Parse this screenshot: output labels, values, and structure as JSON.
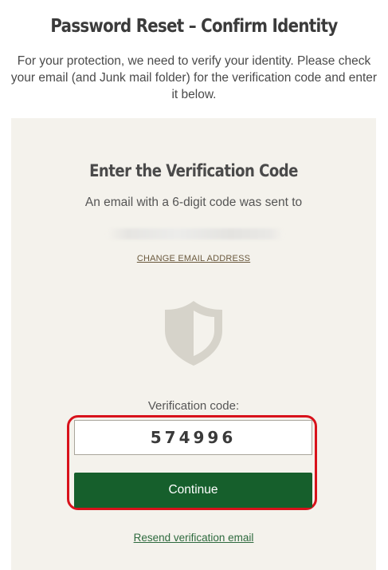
{
  "header": {
    "title": "Password Reset – Confirm Identity",
    "intro": "For your protection, we need to verify your identity. Please check your email (and Junk mail folder) for the verification code and enter it below."
  },
  "card": {
    "title": "Enter the Verification Code",
    "sent_text": "An email with a 6-digit code was sent to",
    "change_email_label": "CHANGE EMAIL ADDRESS",
    "code_label": "Verification code:",
    "code_value": "574996",
    "continue_label": "Continue",
    "resend_label": "Resend verification email"
  },
  "icons": {
    "shield": "shield-icon"
  },
  "colors": {
    "card_background": "#f4f2ec",
    "primary_button": "#165f2c",
    "highlight_border": "#d8121b",
    "link_brown": "#6b5a3e",
    "link_green": "#2e6a3e"
  }
}
